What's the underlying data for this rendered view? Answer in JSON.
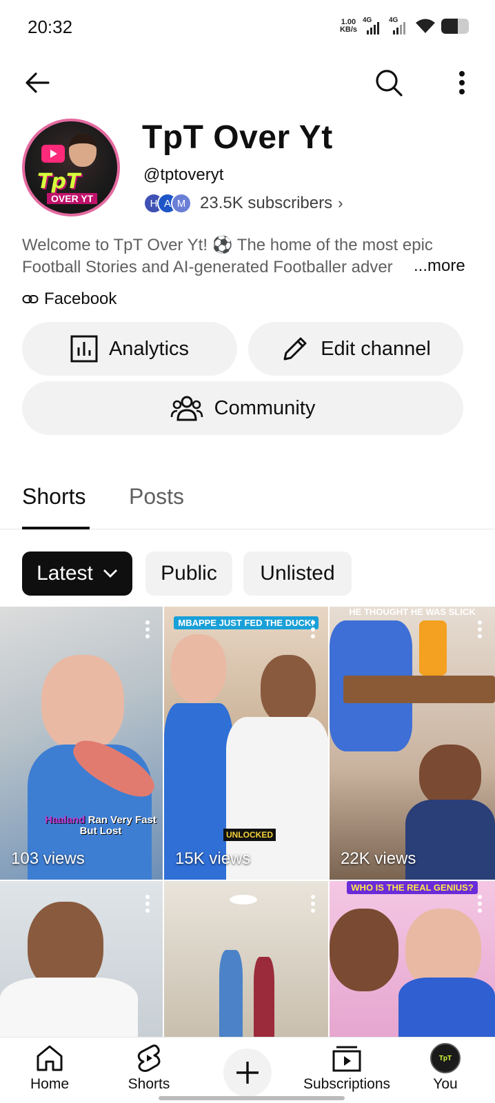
{
  "status_bar": {
    "time": "20:32",
    "net_speed_value": "1.00",
    "net_speed_unit": "KB/s",
    "signal1": "4G",
    "signal2": "4G",
    "battery_level": 0.6
  },
  "top_bar": {
    "back_icon": "arrow-left-icon",
    "search_icon": "search-icon",
    "more_icon": "more-vertical-icon"
  },
  "channel": {
    "title": "TpT Over Yt",
    "handle": "@tptoveryt",
    "avatar_logo_text": "TpT",
    "avatar_sub_text": "OVER YT",
    "subscriber_avatars": [
      {
        "letter": "H",
        "color": "#3f51b5"
      },
      {
        "letter": "A",
        "color": "#1e56c8"
      },
      {
        "letter": "M",
        "color": "#6b7fd6"
      }
    ],
    "subscribers": "23.5K subscribers",
    "description": "Welcome to TpT Over Yt! ⚽ The home of the most epic Football Stories and AI-generated Footballer adver",
    "more_label": "...more",
    "link_label": "Facebook"
  },
  "actions": {
    "analytics": "Analytics",
    "edit_channel": "Edit channel",
    "community": "Community"
  },
  "tabs": [
    {
      "label": "Shorts",
      "active": true
    },
    {
      "label": "Posts",
      "active": false
    }
  ],
  "filters": {
    "latest": "Latest",
    "public": "Public",
    "unlisted": "Unlisted"
  },
  "shorts": [
    {
      "views": "103 views",
      "caption_name": "Haaland",
      "caption_rest": "Ran Very Fast But Lost"
    },
    {
      "views": "15K views",
      "banner": "MBAPPE JUST FED THE DUCK!",
      "sticker": "UNLOCKED"
    },
    {
      "views": "22K views",
      "banner": "HE THOUGHT HE WAS SLICK"
    },
    {
      "views": ""
    },
    {
      "views": ""
    },
    {
      "views": "",
      "banner": "WHO IS THE REAL GENIUS?"
    }
  ],
  "bottom_nav": {
    "home": "Home",
    "shorts": "Shorts",
    "subscriptions": "Subscriptions",
    "you": "You",
    "you_avatar_text": "TpT"
  },
  "colors": {
    "accent_dark": "#0f0f0f",
    "chip_bg": "#f2f2f2",
    "secondary_text": "#606060"
  }
}
